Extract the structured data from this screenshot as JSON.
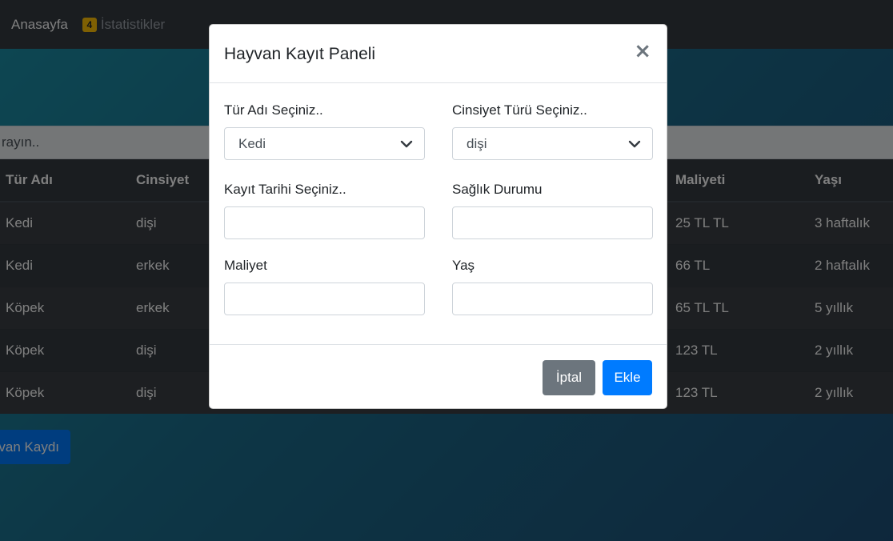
{
  "navbar": {
    "home_label": "Anasayfa",
    "stats_badge": "4",
    "stats_label": "İstatistikler"
  },
  "search": {
    "placeholder": "rayın.."
  },
  "table": {
    "headers": [
      "Tür Adı",
      "Cinsiyet",
      "Maliyeti",
      "Yaşı"
    ],
    "rows": [
      [
        "Kedi",
        "dişi",
        "25 TL TL",
        "3 haftalık"
      ],
      [
        "Kedi",
        "erkek",
        "66 TL",
        "2 haftalık"
      ],
      [
        "Köpek",
        "erkek",
        "65 TL TL",
        "5 yıllık"
      ],
      [
        "Köpek",
        "dişi",
        "123 TL",
        "2 yıllık"
      ],
      [
        "Köpek",
        "dişi",
        "123 TL",
        "2 yıllık"
      ]
    ]
  },
  "page_button": {
    "label": "van Kaydı"
  },
  "modal": {
    "title": "Hayvan Kayıt Paneli",
    "close_symbol": "×",
    "species_label": "Tür Adı Seçiniz..",
    "species_value": "Kedi",
    "gender_label": "Cinsiyet Türü Seçiniz..",
    "gender_value": "dişi",
    "date_label": "Kayıt Tarihi Seçiniz..",
    "health_label": "Sağlık Durumu",
    "cost_label": "Maliyet",
    "age_label": "Yaş",
    "cancel_label": "İptal",
    "add_label": "Ekle"
  },
  "colors": {
    "navbar_bg": "#343a40",
    "primary": "#007bff",
    "secondary": "#6c757d",
    "badge": "#ffc107",
    "backdrop_gradient": [
      "#1b8fa6",
      "#1d4f78"
    ]
  }
}
